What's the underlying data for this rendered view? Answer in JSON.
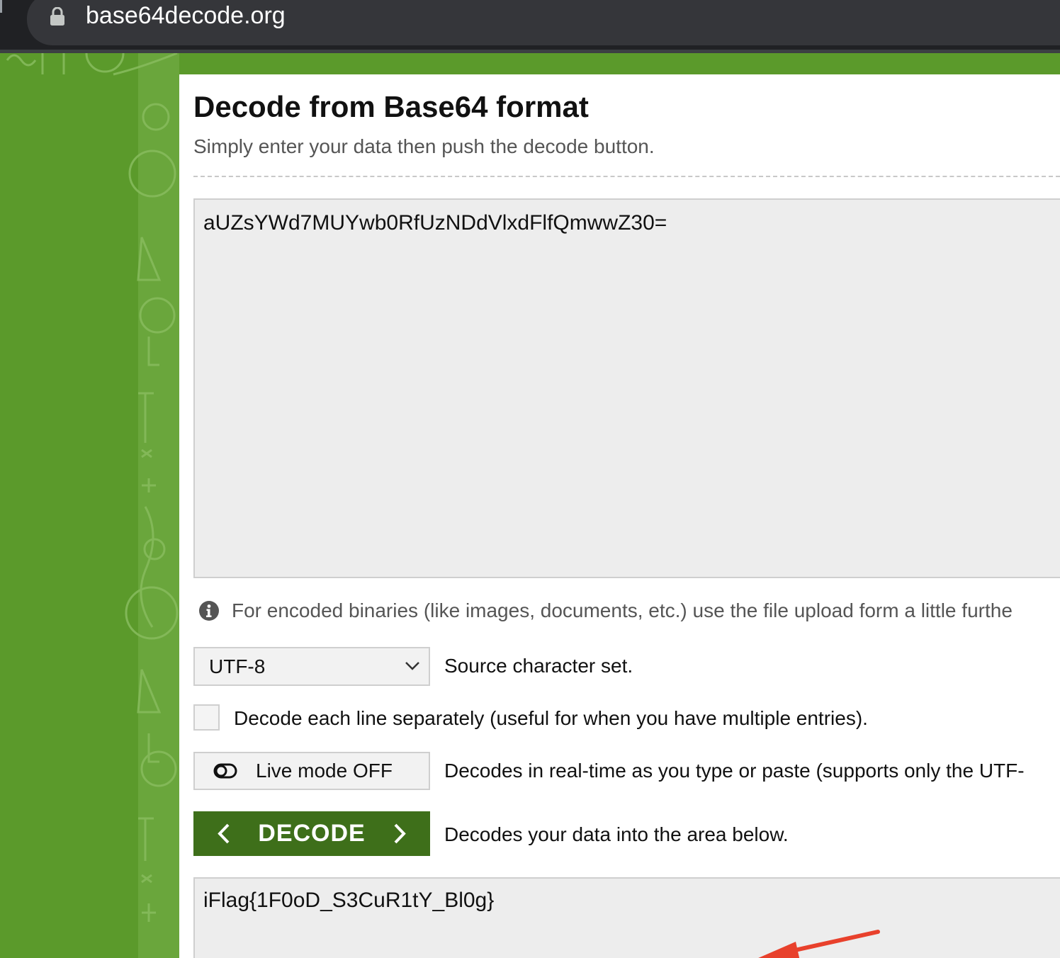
{
  "browser": {
    "url": "base64decode.org"
  },
  "page": {
    "title": "Decode from Base64 format",
    "subtitle": "Simply enter your data then push the decode button."
  },
  "input": {
    "value": "aUZsYWd7MUYwb0RfUzNDdVlxdFlfQmwwZ30="
  },
  "info": {
    "text": "For encoded binaries (like images, documents, etc.) use the file upload form a little furthe"
  },
  "charset": {
    "selected": "UTF-8",
    "description": "Source character set."
  },
  "line_option": {
    "checked": false,
    "label": "Decode each line separately (useful for when you have multiple entries)."
  },
  "live_mode": {
    "label": "Live mode OFF",
    "description": "Decodes in real-time as you type or paste (supports only the UTF-"
  },
  "decode": {
    "label": "DECODE",
    "description": "Decodes your data into the area below."
  },
  "output": {
    "value": "iFlag{1F0oD_S3CuR1tY_Bl0g}"
  },
  "colors": {
    "brand_green": "#5b9a2b",
    "button_green": "#3e6f1a",
    "annotation_red": "#e8412c"
  }
}
